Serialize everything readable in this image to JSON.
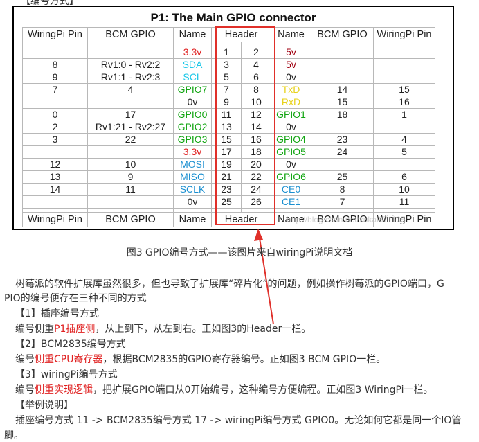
{
  "top_label": "【编号方式】",
  "figure": {
    "title": "P1: The Main GPIO connector",
    "columns": [
      "WiringPi Pin",
      "BCM GPIO",
      "Name",
      "Header",
      "Name",
      "BCM GPIO",
      "WiringPi Pin"
    ],
    "rows": [
      {
        "wl": "",
        "bl": "",
        "nl": "3.3v",
        "nlc": "c-red",
        "h1": "1",
        "h2": "2",
        "nr": "5v",
        "nrc": "c-dred",
        "br": "",
        "wr": ""
      },
      {
        "wl": "8",
        "bl": "Rv1:0 - Rv2:2",
        "nl": "SDA",
        "nlc": "c-cyan",
        "h1": "3",
        "h2": "4",
        "nr": "5v",
        "nrc": "c-dred",
        "br": "",
        "wr": ""
      },
      {
        "wl": "9",
        "bl": "Rv1:1 - Rv2:3",
        "nl": "SCL",
        "nlc": "c-cyan",
        "h1": "5",
        "h2": "6",
        "nr": "0v",
        "nrc": "",
        "br": "",
        "wr": ""
      },
      {
        "wl": "7",
        "bl": "4",
        "nl": "GPIO7",
        "nlc": "c-green",
        "h1": "7",
        "h2": "8",
        "nr": "TxD",
        "nrc": "c-yellow",
        "br": "14",
        "wr": "15"
      },
      {
        "wl": "",
        "bl": "",
        "nl": "0v",
        "nlc": "",
        "h1": "9",
        "h2": "10",
        "nr": "RxD",
        "nrc": "c-yellow",
        "br": "15",
        "wr": "16"
      },
      {
        "wl": "0",
        "bl": "17",
        "nl": "GPIO0",
        "nlc": "c-green",
        "h1": "11",
        "h2": "12",
        "nr": "GPIO1",
        "nrc": "c-green",
        "br": "18",
        "wr": "1"
      },
      {
        "wl": "2",
        "bl": "Rv1:21 - Rv2:27",
        "nl": "GPIO2",
        "nlc": "c-green",
        "h1": "13",
        "h2": "14",
        "nr": "0v",
        "nrc": "",
        "br": "",
        "wr": ""
      },
      {
        "wl": "3",
        "bl": "22",
        "nl": "GPIO3",
        "nlc": "c-green",
        "h1": "15",
        "h2": "16",
        "nr": "GPIO4",
        "nrc": "c-green",
        "br": "23",
        "wr": "4"
      },
      {
        "wl": "",
        "bl": "",
        "nl": "3.3v",
        "nlc": "c-red",
        "h1": "17",
        "h2": "18",
        "nr": "GPIO5",
        "nrc": "c-green",
        "br": "24",
        "wr": "5"
      },
      {
        "wl": "12",
        "bl": "10",
        "nl": "MOSI",
        "nlc": "c-blue",
        "h1": "19",
        "h2": "20",
        "nr": "0v",
        "nrc": "",
        "br": "",
        "wr": ""
      },
      {
        "wl": "13",
        "bl": "9",
        "nl": "MISO",
        "nlc": "c-blue",
        "h1": "21",
        "h2": "22",
        "nr": "GPIO6",
        "nrc": "c-green",
        "br": "25",
        "wr": "6"
      },
      {
        "wl": "14",
        "bl": "11",
        "nl": "SCLK",
        "nlc": "c-blue",
        "h1": "23",
        "h2": "24",
        "nr": "CE0",
        "nrc": "c-blue",
        "br": "8",
        "wr": "10"
      },
      {
        "wl": "",
        "bl": "",
        "nl": "0v",
        "nlc": "",
        "h1": "25",
        "h2": "26",
        "nr": "CE1",
        "nrc": "c-blue",
        "br": "7",
        "wr": "11"
      }
    ],
    "watermark": "http://blog.csdn.net/xukai871105"
  },
  "caption": "图3 GPIO编号方式——该图片来自wiringPi说明文档",
  "body": {
    "intro_line1": "树莓派的软件扩展库虽然很多，但也导致了扩展库“碎片化”的问题，例如操作树莓派的GPIO端口，G",
    "intro_line2": "PIO的编号便存在三种不同的方式",
    "s1_title": "【1】插座编号方式",
    "s1_pre": "编号侧重",
    "s1_hl": "P1插座侧",
    "s1_post": "，从上到下，从左到右。正如图3的Header一栏。",
    "s2_title": "【2】BCM2835编号方式",
    "s2_pre": "编号",
    "s2_hl": "侧重CPU寄存器",
    "s2_post": "，根据BCM2835的GPIO寄存器编号。正如图3 BCM GPIO一栏。",
    "s3_title": "【3】wiringPi编号方式",
    "s3_pre": "编号",
    "s3_hl": "侧重实现逻辑",
    "s3_post": "，把扩展GPIO端口从0开始编号，这种编号方便编程。正如图3 WiringPi一栏。",
    "ex_title": "【举例说明】",
    "ex_line1": "插座编号方式 11 -> BCM2835编号方式 17 -> wiringPi编号方式 GPIO0。无论如何它都是同一个IO管",
    "ex_line2": "脚。"
  },
  "colors": {
    "highlight": "#e02020",
    "arrow": "#e0302a",
    "box": "#e0302a"
  }
}
